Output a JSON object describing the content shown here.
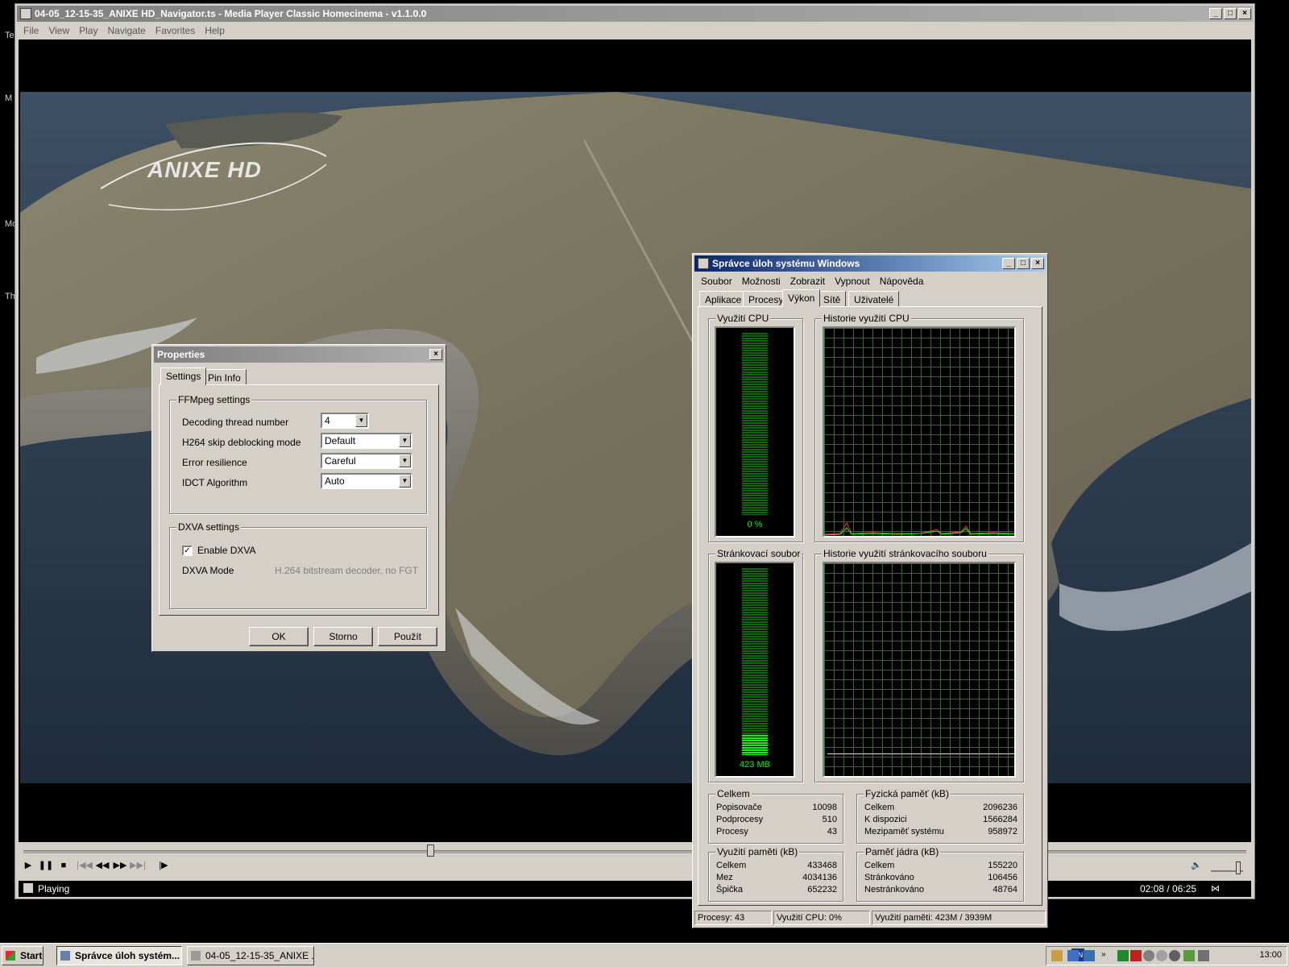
{
  "desktop": {
    "side_text": [
      "Te",
      "M",
      "Mo",
      "Th"
    ]
  },
  "mpc": {
    "title": "04-05_12-15-35_ANIXE HD_Navigator.ts - Media Player Classic Homecinema - v1.1.0.0",
    "menu": [
      "File",
      "View",
      "Play",
      "Navigate",
      "Favorites",
      "Help"
    ],
    "watermark": "ANIXE HD",
    "status": "Playing",
    "time": "02:08 / 06:25",
    "seek_fraction": 0.333,
    "volume_fraction": 0.85
  },
  "props": {
    "title": "Properties",
    "tabs": [
      "Settings",
      "Pin Info"
    ],
    "ffmpeg_group": "FFMpeg settings",
    "rows": [
      {
        "label": "Decoding thread number",
        "value": "4"
      },
      {
        "label": "H264 skip deblocking mode",
        "value": "Default"
      },
      {
        "label": "Error resilience",
        "value": "Careful"
      },
      {
        "label": "IDCT Algorithm",
        "value": "Auto"
      }
    ],
    "dxva_group": "DXVA settings",
    "enable_dxva": "Enable DXVA",
    "dxva_mode_label": "DXVA Mode",
    "dxva_mode_value": "H.264 bitstream decoder, no FGT",
    "buttons": {
      "ok": "OK",
      "cancel": "Storno",
      "apply": "Použít"
    }
  },
  "tm": {
    "title": "Správce úloh systému Windows",
    "menu": [
      "Soubor",
      "Možnosti",
      "Zobrazit",
      "Vypnout",
      "Nápověda"
    ],
    "tabs": [
      "Aplikace",
      "Procesy",
      "Výkon",
      "Sítě",
      "Uživatelé"
    ],
    "cpu_title": "Využití CPU",
    "cpu_value": "0 %",
    "cpu_fraction": 0.0,
    "cpu_hist_title": "Historie využití CPU",
    "pf_title": "Stránkovací soubor",
    "pf_value": "423 MB",
    "pf_fraction": 0.107,
    "pf_hist_title": "Historie využití stránkovacího souboru",
    "totals": {
      "title": "Celkem",
      "rows": [
        [
          "Popisovače",
          "10098"
        ],
        [
          "Podprocesy",
          "510"
        ],
        [
          "Procesy",
          "43"
        ]
      ]
    },
    "physical": {
      "title": "Fyzická paměť (kB)",
      "rows": [
        [
          "Celkem",
          "2096236"
        ],
        [
          "K dispozici",
          "1566284"
        ],
        [
          "Mezipaměť systému",
          "958972"
        ]
      ]
    },
    "commit": {
      "title": "Využití paměti (kB)",
      "rows": [
        [
          "Celkem",
          "433468"
        ],
        [
          "Mez",
          "4034136"
        ],
        [
          "Špička",
          "652232"
        ]
      ]
    },
    "kernel": {
      "title": "Paměť jádra (kB)",
      "rows": [
        [
          "Celkem",
          "155220"
        ],
        [
          "Stránkováno",
          "106456"
        ],
        [
          "Nestránkováno",
          "48764"
        ]
      ]
    },
    "status": {
      "procs": "Procesy: 43",
      "cpu": "Využití CPU: 0%",
      "mem": "Využití paměti: 423M / 3939M"
    }
  },
  "taskbar": {
    "start": "Start",
    "buttons": [
      "Správce úloh systém...",
      "04-05_12-15-35_ANIXE ..."
    ],
    "lang": "EN",
    "clock": "13:00"
  },
  "colors": {
    "title_active": "#0a246a",
    "title_inactive": "#808080",
    "graph_green": "#00ff00",
    "grid": "#008040"
  }
}
